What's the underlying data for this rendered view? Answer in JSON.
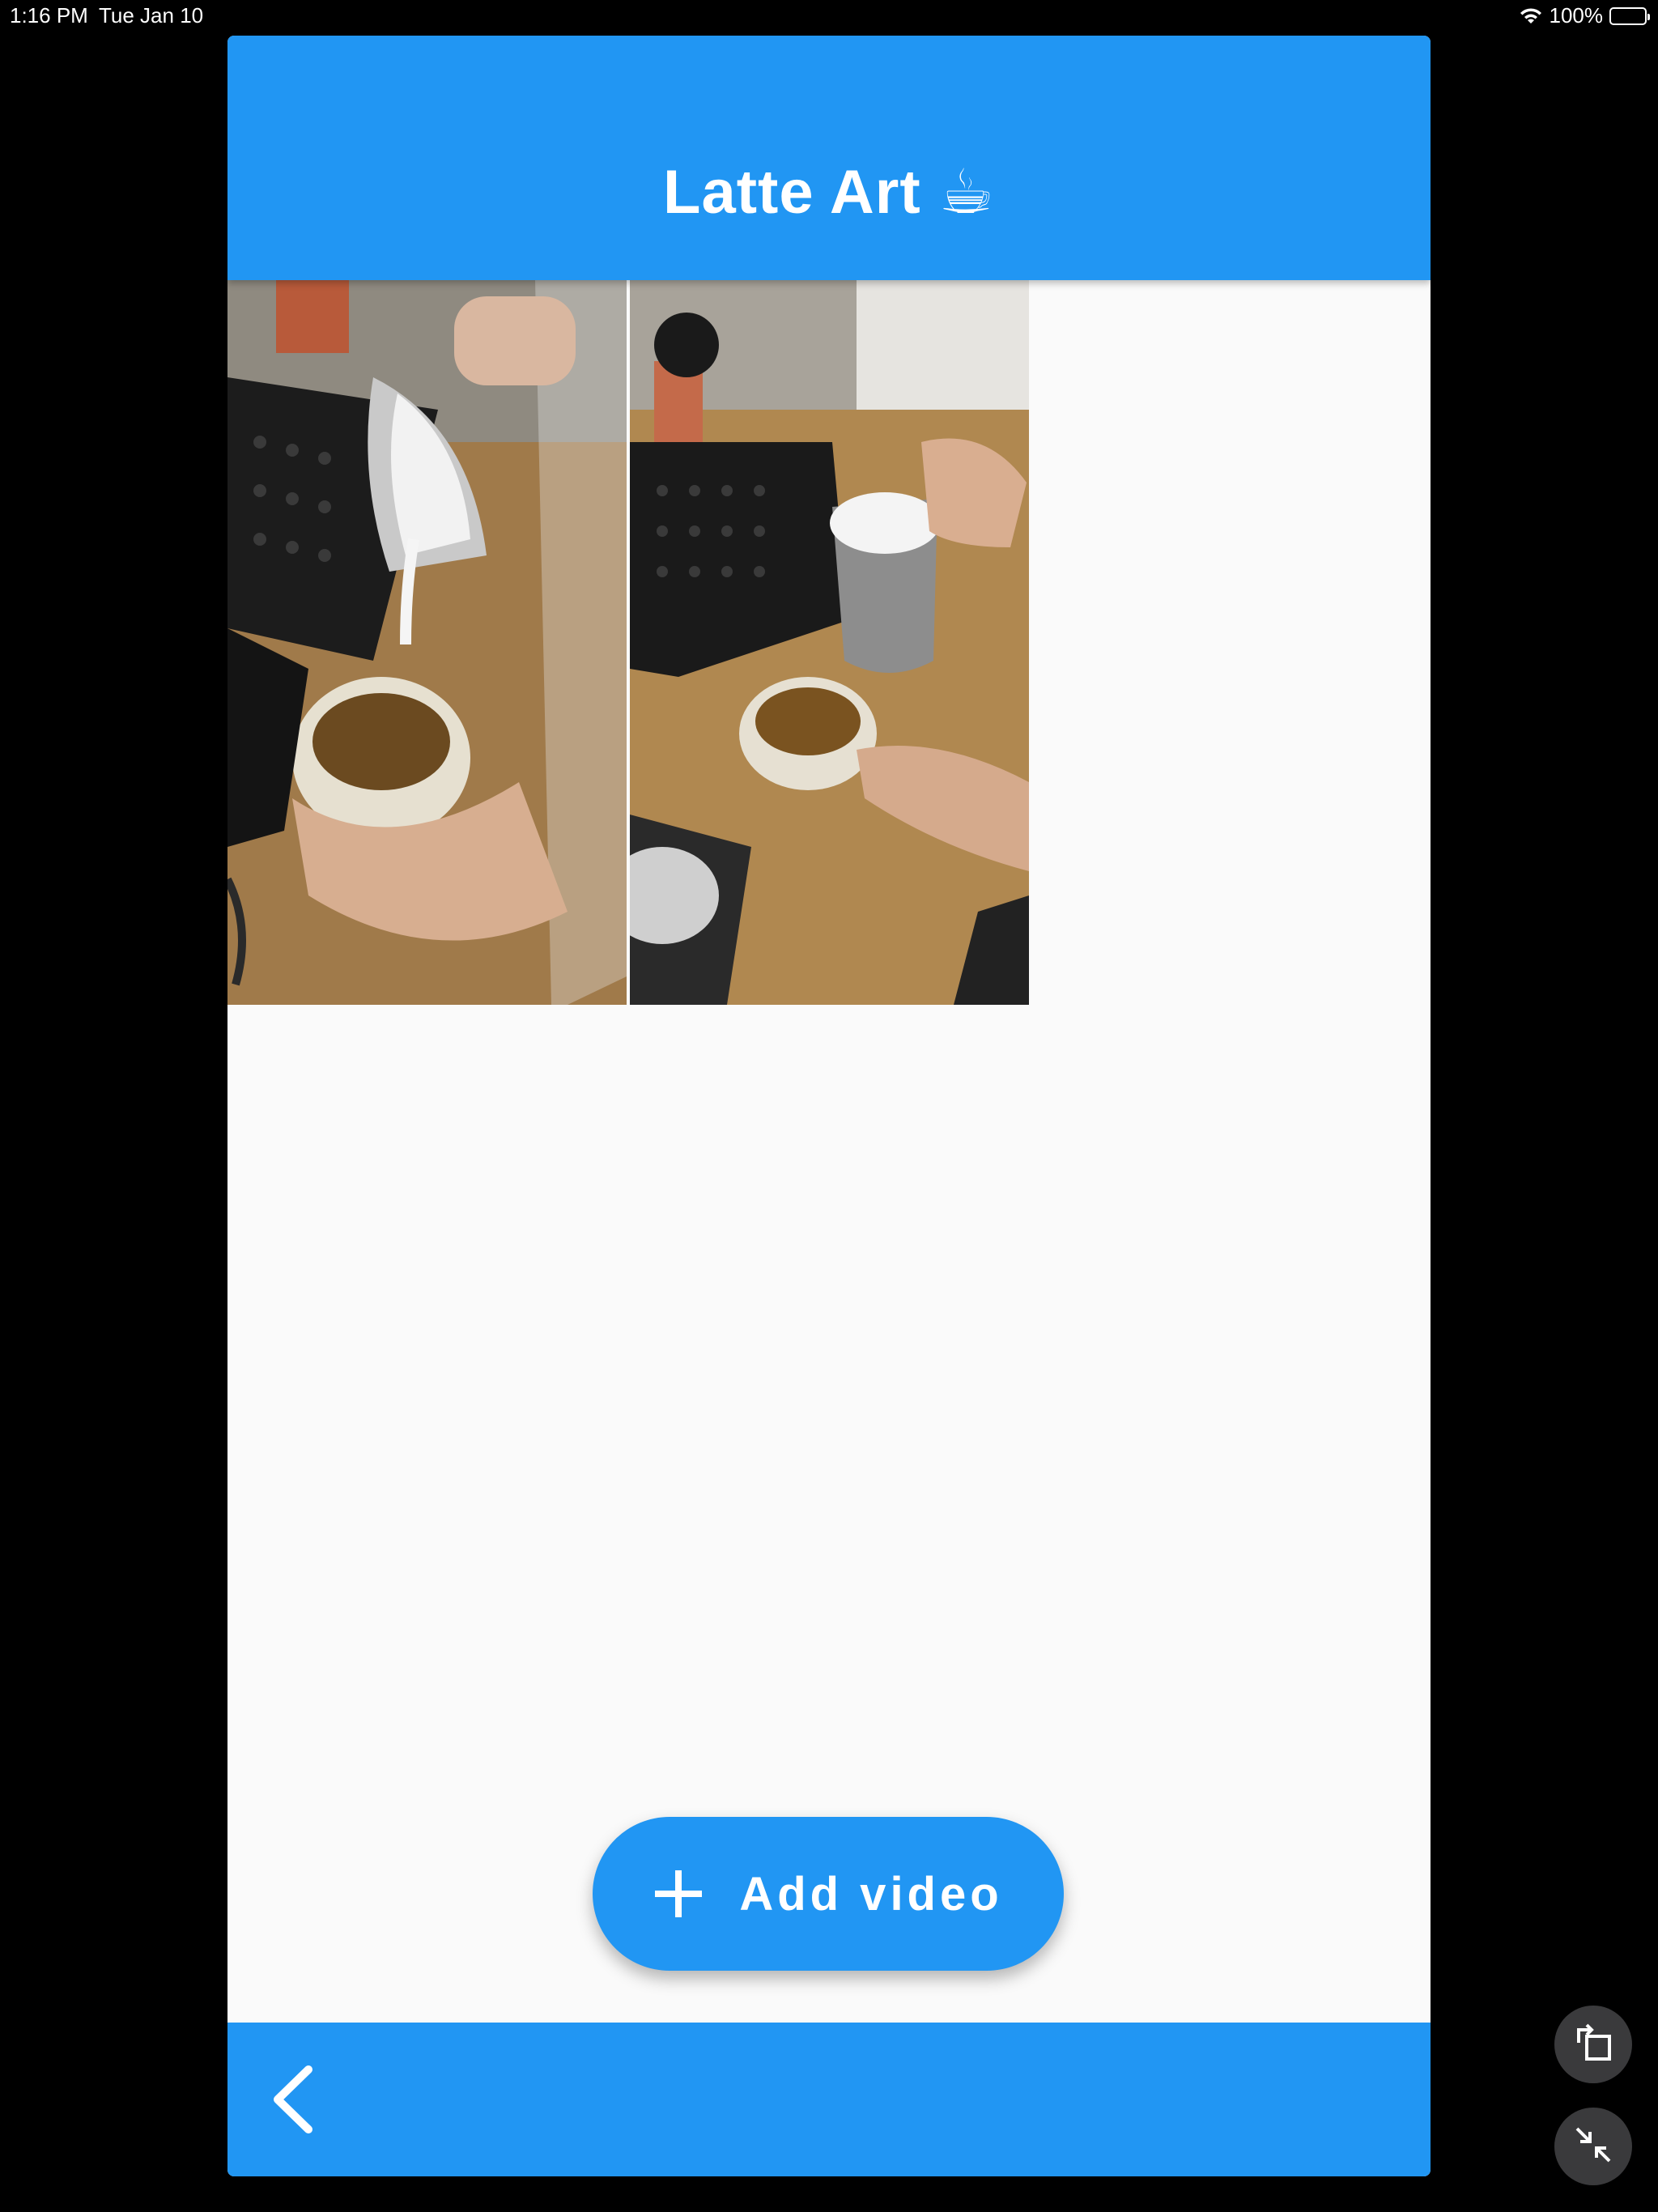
{
  "status_bar": {
    "time": "1:16 PM",
    "date": "Tue Jan 10",
    "battery_percent": "100%",
    "icons": [
      "wifi-icon",
      "battery-icon"
    ]
  },
  "app_bar": {
    "title": "Latte Art ☕"
  },
  "gallery": {
    "items": [
      {
        "name": "video-thumbnail-1",
        "description_icon": "video-thumbnail"
      },
      {
        "name": "video-thumbnail-2",
        "description_icon": "video-thumbnail"
      }
    ]
  },
  "fab": {
    "label": "Add video",
    "icon": "plus-icon"
  },
  "bottom_bar": {
    "icon": "back-chevron-icon"
  },
  "system_buttons": {
    "icons": [
      "rotate-icon",
      "shrink-icon"
    ]
  },
  "colors": {
    "primary": "#2196f3",
    "background": "#fafafa",
    "on_primary": "#ffffff",
    "screen_bg": "#000000"
  }
}
